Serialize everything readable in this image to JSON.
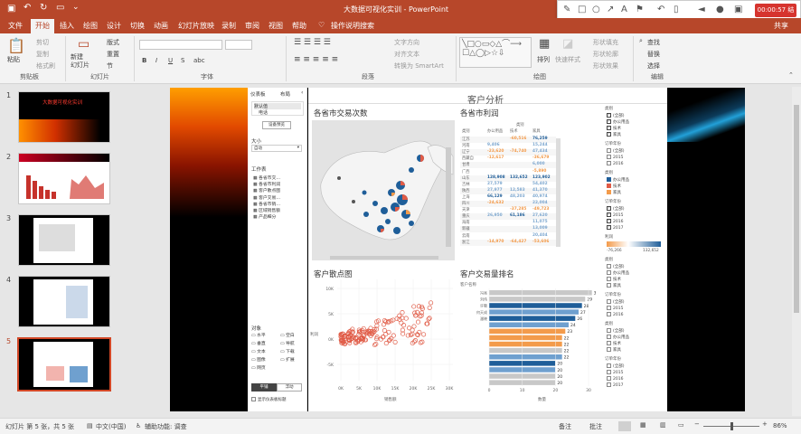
{
  "titlebar": {
    "doc_title": "大数据可视化实训 - PowerPoint"
  },
  "recorder": {
    "time": "00:00:57 结束"
  },
  "tabs": [
    "文件",
    "开始",
    "插入",
    "绘图",
    "设计",
    "切换",
    "动画",
    "幻灯片放映",
    "录制",
    "审阅",
    "视图",
    "帮助"
  ],
  "tell_me": "操作说明搜索",
  "share": "共享",
  "ribbon": {
    "clipboard": {
      "paste": "粘贴",
      "cut": "剪切",
      "copy": "复制",
      "format_painter": "格式刷",
      "group": "剪贴板"
    },
    "slides": {
      "new_slide": "新建\n幻灯片",
      "layout": "版式",
      "reset": "重置",
      "section": "节",
      "group": "幻灯片"
    },
    "font": {
      "group": "字体",
      "b": "B",
      "i": "I",
      "u": "U",
      "s": "S",
      "abc": "abc"
    },
    "paragraph": {
      "group": "段落",
      "text_dir": "文字方向",
      "align_text": "对齐文本",
      "smartart": "转换为 SmartArt"
    },
    "drawing": {
      "arrange": "排列",
      "quick_styles": "快速样式",
      "fill": "形状填充",
      "outline": "形状轮廓",
      "effects": "形状效果",
      "group": "绘图"
    },
    "editing": {
      "find": "查找",
      "replace": "替换",
      "select": "选择",
      "group": "编辑"
    }
  },
  "thumbs": [
    {
      "num": "1",
      "title": "大数据可视化实训"
    },
    {
      "num": "2"
    },
    {
      "num": "3"
    },
    {
      "num": "4"
    },
    {
      "num": "5"
    }
  ],
  "dashboard_panel": {
    "tab_dashboard": "仪表板",
    "tab_layout": "布局",
    "default": "默认值",
    "phone": "电话",
    "device_preview": "设备预览",
    "size_label": "大小",
    "size_value": "自动",
    "sheets_label": "工作表",
    "sheets": [
      "各省市交…",
      "各省市利润",
      "客户散点图",
      "客户交易…",
      "各省市销…",
      "区域销售额",
      "产品细分"
    ],
    "objects_label": "对象",
    "objects": [
      "水平",
      "垂直",
      "文本",
      "图像",
      "网页",
      "空白",
      "导航",
      "下载",
      "扩展"
    ],
    "tiled": "平铺",
    "floating": "浮动",
    "show_title": "显示仪表板标题"
  },
  "dashboard": {
    "title": "客户分析",
    "map_title": "各省市交易次数",
    "profit_title": "各省市利润",
    "scatter_title": "客户散点图",
    "rank_title": "客户交易量排名",
    "scatter_ylabel": "利润",
    "scatter_xlabel": "销售额",
    "rank_xlabel": "数量",
    "rank_ylabel": "客户名称"
  },
  "profit_table": {
    "header": [
      "类别",
      "办公用品",
      "技术",
      "家具"
    ],
    "rows": [
      [
        "江苏",
        "",
        "-60,516",
        "76,259"
      ],
      [
        "河南",
        "9,406",
        "",
        "15,244"
      ],
      [
        "辽宁",
        "-23,620",
        "-74,740",
        "47,434"
      ],
      [
        "西藏自",
        "-12,617",
        "",
        "-36,679"
      ],
      [
        "甘肃",
        "",
        "",
        "6,000"
      ],
      [
        "广西",
        "",
        "",
        "-5,890"
      ],
      [
        "山东",
        "128,908",
        "132,652",
        "123,902"
      ],
      [
        "吉林",
        "27,579",
        "",
        "54,402"
      ],
      [
        "陕西",
        "27,977",
        "12,583",
        "41,370"
      ],
      [
        "上海",
        "66,129",
        "48,203",
        "40,974"
      ],
      [
        "四川",
        "-24,632",
        "",
        "22,004"
      ],
      [
        "天津",
        "",
        "-37,285",
        "-49,723"
      ],
      [
        "重庆",
        "26,950",
        "61,186",
        "27,620"
      ],
      [
        "海南",
        "",
        "",
        "11,075"
      ],
      [
        "新疆",
        "",
        "",
        "13,009"
      ],
      [
        "云南",
        "",
        "",
        "20,404"
      ],
      [
        "浙江",
        "-14,970",
        "-64,427",
        "-53,606"
      ]
    ]
  },
  "scatter": {
    "y_ticks": [
      "10K",
      "5K",
      "0K",
      "-5K"
    ],
    "x_ticks": [
      "0K",
      "5K",
      "10K",
      "15K",
      "20K",
      "25K",
      "30K"
    ]
  },
  "chart_data": {
    "type": "bar",
    "title": "客户交易量排名",
    "categories": [
      "冯亮",
      "刘伟",
      "许敬",
      "何天成",
      "潘晓",
      "",
      "",
      "",
      "",
      "",
      "",
      "",
      "",
      "",
      ""
    ],
    "values": [
      31,
      29,
      28,
      27,
      26,
      24,
      23,
      22,
      22,
      22,
      22,
      20,
      20,
      20,
      20
    ],
    "xlabel": "数量",
    "ylabel": "客户名称",
    "xlim": [
      0,
      30
    ],
    "x_ticks": [
      "0",
      "10",
      "20",
      "30"
    ]
  },
  "filters": {
    "category_label": "类别",
    "category_items": [
      "(全部)",
      "办公用品",
      "技术",
      "家具"
    ],
    "year_label": "订单年份",
    "year_items": [
      "(全部)",
      "2015",
      "2016"
    ],
    "legend_label": "类别",
    "legend_items": [
      "办公用品",
      "技术",
      "家具"
    ],
    "year2_items": [
      "(全部)",
      "2015",
      "2016",
      "2017"
    ],
    "profit_label": "利润",
    "profit_min": "-76,266",
    "profit_max": "132,652",
    "cat2_items": [
      "(全部)",
      "办公用品",
      "技术",
      "家具"
    ],
    "year3_items": [
      "(全部)",
      "2015",
      "2016"
    ],
    "cat3_items": [
      "(全部)",
      "办公用品",
      "技术",
      "家具"
    ],
    "year4_items": [
      "(全部)",
      "2015",
      "2016",
      "2017"
    ]
  },
  "status": {
    "slide_info": "幻灯片 第 5 张，共 5 张",
    "lang": "中文(中国)",
    "access": "辅助功能: 调查",
    "notes": "备注",
    "comments": "批注",
    "zoom": "86%"
  },
  "colors": {
    "accent": "#b7472a",
    "office": "#1f5e99",
    "tech": "#e05b46",
    "furn": "#f39b4b"
  }
}
